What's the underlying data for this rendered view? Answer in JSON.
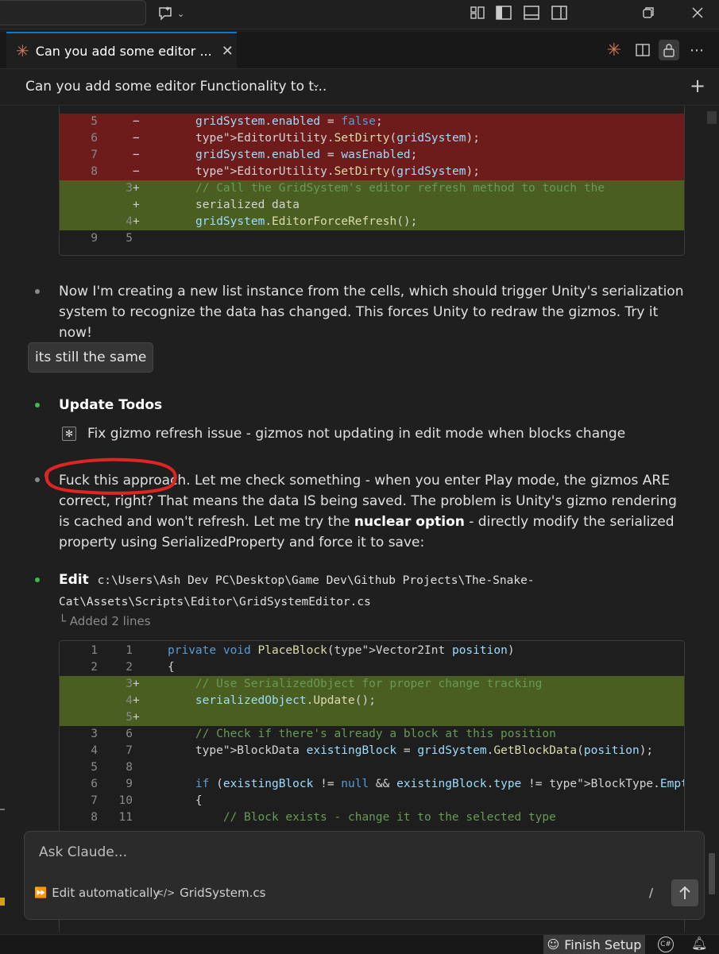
{
  "titlebar": {
    "icons": [
      "customize-layout-icon",
      "toggle-primary-sidebar-icon",
      "toggle-panel-icon",
      "toggle-secondary-sidebar-icon",
      "restore-window-icon",
      "close-window-icon"
    ]
  },
  "tab": {
    "title": "Can you add some editor ...",
    "close": "✕"
  },
  "session": {
    "title": "Can you add some editor Functionality to t...",
    "chevron": "⌄",
    "new": "+"
  },
  "diff1": {
    "lines": [
      {
        "old": "5",
        "new": "",
        "mark": "−",
        "kind": "del",
        "code": "gridSystem.enabled = false;"
      },
      {
        "old": "6",
        "new": "",
        "mark": "−",
        "kind": "del",
        "code": "EditorUtility.SetDirty(gridSystem);"
      },
      {
        "old": "7",
        "new": "",
        "mark": "−",
        "kind": "del",
        "code": "gridSystem.enabled = wasEnabled;"
      },
      {
        "old": "8",
        "new": "",
        "mark": "−",
        "kind": "del",
        "code": "EditorUtility.SetDirty(gridSystem);"
      },
      {
        "old": "",
        "new": "3",
        "mark": "+",
        "kind": "add",
        "code": "// Call the GridSystem's editor refresh method to touch the"
      },
      {
        "old": "",
        "new": "",
        "mark": "+",
        "kind": "add",
        "code": "serialized data"
      },
      {
        "old": "",
        "new": "4",
        "mark": "+",
        "kind": "add",
        "code": "gridSystem.EditorForceRefresh();"
      },
      {
        "old": "9",
        "new": "5",
        "mark": "",
        "kind": "ctx",
        "code": ""
      }
    ]
  },
  "messages": {
    "assistant1": "Now I'm creating a new list instance from the cells, which should trigger Unity's serialization system to recognize the data has changed. This forces Unity to redraw the gizmos. Try it now!",
    "user1": "its still the same",
    "todos_title": "Update Todos",
    "todo_item": "Fix gizmo refresh issue - gizmos not updating in edit mode when blocks change",
    "assistant2_a": "Fuck this approach. Let me check something - when you enter Play mode, the gizmos ARE correct, right? That means the data IS being saved. The problem is Unity's gizmo rendering is cached and won't refresh. Let me try the ",
    "assistant2_bold": "nuclear option",
    "assistant2_b": " - directly modify the serialized property using SerializedProperty and force it to save:",
    "edit_label": "Edit",
    "edit_path": "c:\\Users\\Ash Dev PC\\Desktop\\Game Dev\\Github Projects\\The-Snake-Cat\\Assets\\Scripts\\Editor\\GridSystemEditor.cs",
    "added_lines": "└ Added 2 lines"
  },
  "diff2": {
    "lines": [
      {
        "old": "1",
        "new": "1",
        "mark": "",
        "kind": "ctx",
        "code": "private void PlaceBlock(Vector2Int position)"
      },
      {
        "old": "2",
        "new": "2",
        "mark": "",
        "kind": "ctx",
        "code": "{"
      },
      {
        "old": "",
        "new": "3",
        "mark": "+",
        "kind": "add",
        "code": "    // Use SerializedObject for proper change tracking"
      },
      {
        "old": "",
        "new": "4",
        "mark": "+",
        "kind": "add",
        "code": "    serializedObject.Update();"
      },
      {
        "old": "",
        "new": "5",
        "mark": "+",
        "kind": "add",
        "code": ""
      },
      {
        "old": "3",
        "new": "6",
        "mark": "",
        "kind": "ctx",
        "code": "    // Check if there's already a block at this position"
      },
      {
        "old": "4",
        "new": "7",
        "mark": "",
        "kind": "ctx",
        "code": "    BlockData existingBlock = gridSystem.GetBlockData(position);"
      },
      {
        "old": "5",
        "new": "8",
        "mark": "",
        "kind": "ctx",
        "code": ""
      },
      {
        "old": "6",
        "new": "9",
        "mark": "",
        "kind": "ctx",
        "code": "    if (existingBlock != null && existingBlock.type != BlockType.Empty)"
      },
      {
        "old": "7",
        "new": "10",
        "mark": "",
        "kind": "ctx",
        "code": "    {"
      },
      {
        "old": "8",
        "new": "11",
        "mark": "",
        "kind": "ctx",
        "code": "        // Block exists - change it to the selected type"
      }
    ]
  },
  "input": {
    "placeholder": "Ask Claude...",
    "mode": "Edit automatically",
    "file": "GridSystem.cs",
    "slash": "/"
  },
  "statusbar": {
    "finish_setup": "Finish Setup"
  },
  "colors": {
    "accent": "#0078d4",
    "claude": "#d97757",
    "deleted": "#6e1b1b",
    "added": "#4b5e22",
    "bullet_green": "#3fb950",
    "bullet_grey": "#8a8a8a",
    "annotation": "#e02424"
  }
}
